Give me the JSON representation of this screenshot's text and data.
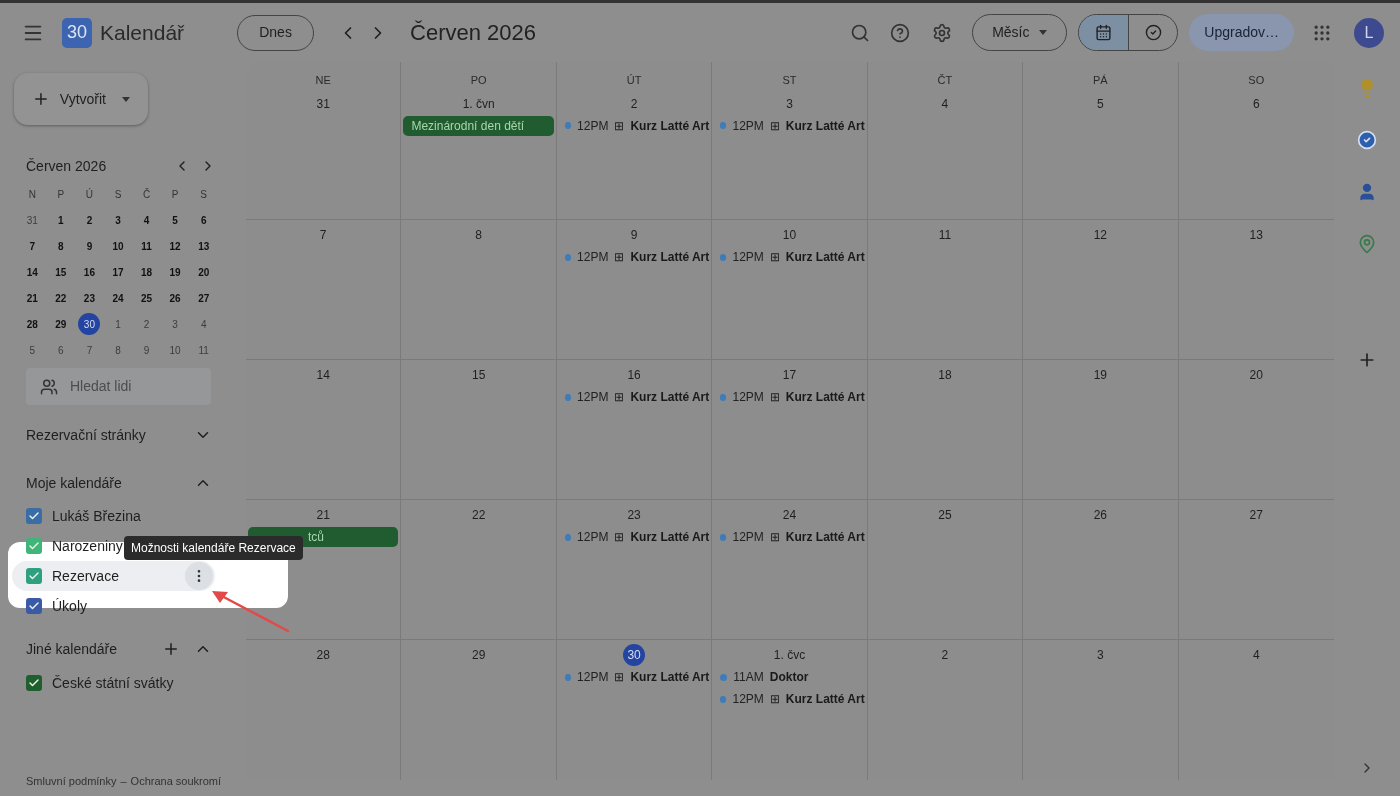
{
  "header": {
    "logo_number": "30",
    "app_name": "Kalendář",
    "today_button": "Dnes",
    "title": "Červen 2026",
    "view_select": "Měsíc",
    "view_toggle": [
      {
        "kind": "calendar",
        "selected": true
      },
      {
        "kind": "tasks",
        "selected": false
      }
    ],
    "upgrade_button": "Upgradov…",
    "avatar": "L"
  },
  "sidebar": {
    "create_button": "Vytvořit",
    "mini_calendar": {
      "title": "Červen 2026",
      "weekdays": [
        "N",
        "P",
        "Ú",
        "S",
        "Č",
        "P",
        "S"
      ],
      "weeks": [
        [
          {
            "label": "31",
            "kind": "outside"
          },
          {
            "label": "1",
            "kind": "current"
          },
          {
            "label": "2",
            "kind": "current"
          },
          {
            "label": "3",
            "kind": "current"
          },
          {
            "label": "4",
            "kind": "current"
          },
          {
            "label": "5",
            "kind": "current"
          },
          {
            "label": "6",
            "kind": "current"
          }
        ],
        [
          {
            "label": "7",
            "kind": "current"
          },
          {
            "label": "8",
            "kind": "current"
          },
          {
            "label": "9",
            "kind": "current"
          },
          {
            "label": "10",
            "kind": "current"
          },
          {
            "label": "11",
            "kind": "current"
          },
          {
            "label": "12",
            "kind": "current"
          },
          {
            "label": "13",
            "kind": "current"
          }
        ],
        [
          {
            "label": "14",
            "kind": "current"
          },
          {
            "label": "15",
            "kind": "current"
          },
          {
            "label": "16",
            "kind": "current"
          },
          {
            "label": "17",
            "kind": "current"
          },
          {
            "label": "18",
            "kind": "current"
          },
          {
            "label": "19",
            "kind": "current"
          },
          {
            "label": "20",
            "kind": "current"
          }
        ],
        [
          {
            "label": "21",
            "kind": "current"
          },
          {
            "label": "22",
            "kind": "current"
          },
          {
            "label": "23",
            "kind": "current"
          },
          {
            "label": "24",
            "kind": "current"
          },
          {
            "label": "25",
            "kind": "current"
          },
          {
            "label": "26",
            "kind": "current"
          },
          {
            "label": "27",
            "kind": "current"
          }
        ],
        [
          {
            "label": "28",
            "kind": "current"
          },
          {
            "label": "29",
            "kind": "current"
          },
          {
            "label": "30",
            "kind": "today"
          },
          {
            "label": "1",
            "kind": "outside"
          },
          {
            "label": "2",
            "kind": "outside"
          },
          {
            "label": "3",
            "kind": "outside"
          },
          {
            "label": "4",
            "kind": "outside"
          }
        ],
        [
          {
            "label": "5",
            "kind": "outside"
          },
          {
            "label": "6",
            "kind": "outside"
          },
          {
            "label": "7",
            "kind": "outside"
          },
          {
            "label": "8",
            "kind": "outside"
          },
          {
            "label": "9",
            "kind": "outside"
          },
          {
            "label": "10",
            "kind": "outside"
          },
          {
            "label": "11",
            "kind": "outside"
          }
        ]
      ]
    },
    "people_search": {
      "placeholder": "Hledat lidi"
    },
    "booking_pages": {
      "title": "Rezervační stránky",
      "expanded": false
    },
    "my_calendars": {
      "title": "Moje kalendáře",
      "expanded": true,
      "items": [
        {
          "label": "Lukáš Březina",
          "checked": true,
          "color": "#3a6ca6",
          "highlighted": false
        },
        {
          "label": "Narozeniny",
          "checked": true,
          "color": "#3fb57a",
          "highlighted": false
        },
        {
          "label": "Rezervace",
          "checked": true,
          "color": "#2e9f7f",
          "highlighted": true
        },
        {
          "label": "Úkoly",
          "checked": true,
          "color": "#3a5aa8",
          "highlighted": false
        }
      ]
    },
    "tooltip": "Možnosti kalendáře Rezervace",
    "other_calendars": {
      "title": "Jiné kalendáře",
      "expanded": true,
      "items": [
        {
          "label": "České státní svátky",
          "checked": true,
          "color": "#1f5e2d",
          "highlighted": false
        }
      ]
    },
    "footer": {
      "links": [
        "Smluvní podmínky",
        "Ochrana soukromí"
      ],
      "separator": "–"
    }
  },
  "month_grid": {
    "weekdays": [
      "NE",
      "PO",
      "ÚT",
      "ST",
      "ČT",
      "PÁ",
      "SO"
    ],
    "weeks": [
      [
        {
          "date": "31",
          "today": false
        },
        {
          "date": "1. čvn",
          "today": false,
          "events": [
            {
              "kind": "allday",
              "title": "Mezinárodní den dětí"
            }
          ]
        },
        {
          "date": "2",
          "today": false,
          "events": [
            {
              "kind": "timed",
              "time": "12PM",
              "glyph": "⊞",
              "title": "Kurz Latté Art"
            }
          ]
        },
        {
          "date": "3",
          "today": false,
          "events": [
            {
              "kind": "timed",
              "time": "12PM",
              "glyph": "⊞",
              "title": "Kurz Latté Art"
            }
          ]
        },
        {
          "date": "4",
          "today": false
        },
        {
          "date": "5",
          "today": false
        },
        {
          "date": "6",
          "today": false
        }
      ],
      [
        {
          "date": "7",
          "today": false
        },
        {
          "date": "8",
          "today": false
        },
        {
          "date": "9",
          "today": false,
          "events": [
            {
              "kind": "timed",
              "time": "12PM",
              "glyph": "⊞",
              "title": "Kurz Latté Art"
            }
          ]
        },
        {
          "date": "10",
          "today": false,
          "events": [
            {
              "kind": "timed",
              "time": "12PM",
              "glyph": "⊞",
              "title": "Kurz Latté Art"
            }
          ]
        },
        {
          "date": "11",
          "today": false
        },
        {
          "date": "12",
          "today": false
        },
        {
          "date": "13",
          "today": false
        }
      ],
      [
        {
          "date": "14",
          "today": false
        },
        {
          "date": "15",
          "today": false
        },
        {
          "date": "16",
          "today": false,
          "events": [
            {
              "kind": "timed",
              "time": "12PM",
              "glyph": "⊞",
              "title": "Kurz Latté Art"
            }
          ]
        },
        {
          "date": "17",
          "today": false,
          "events": [
            {
              "kind": "timed",
              "time": "12PM",
              "glyph": "⊞",
              "title": "Kurz Latté Art"
            }
          ]
        },
        {
          "date": "18",
          "today": false
        },
        {
          "date": "19",
          "today": false
        },
        {
          "date": "20",
          "today": false
        }
      ],
      [
        {
          "date": "21",
          "today": false,
          "events": [
            {
              "kind": "allday-covered",
              "title": "tců"
            }
          ]
        },
        {
          "date": "22",
          "today": false
        },
        {
          "date": "23",
          "today": false,
          "events": [
            {
              "kind": "timed",
              "time": "12PM",
              "glyph": "⊞",
              "title": "Kurz Latté Art"
            }
          ]
        },
        {
          "date": "24",
          "today": false,
          "events": [
            {
              "kind": "timed",
              "time": "12PM",
              "glyph": "⊞",
              "title": "Kurz Latté Art"
            }
          ]
        },
        {
          "date": "25",
          "today": false
        },
        {
          "date": "26",
          "today": false
        },
        {
          "date": "27",
          "today": false
        }
      ],
      [
        {
          "date": "28",
          "today": false
        },
        {
          "date": "29",
          "today": false
        },
        {
          "date": "30",
          "today": true,
          "events": [
            {
              "kind": "timed",
              "time": "12PM",
              "glyph": "⊞",
              "title": "Kurz Latté Art"
            }
          ]
        },
        {
          "date": "1. čvc",
          "today": false,
          "events": [
            {
              "kind": "timed",
              "time": "11AM",
              "title": "Doktor"
            },
            {
              "kind": "timed",
              "time": "12PM",
              "glyph": "⊞",
              "title": "Kurz Latté Art"
            }
          ]
        },
        {
          "date": "2",
          "today": false
        },
        {
          "date": "3",
          "today": false
        },
        {
          "date": "4",
          "today": false
        }
      ]
    ]
  }
}
